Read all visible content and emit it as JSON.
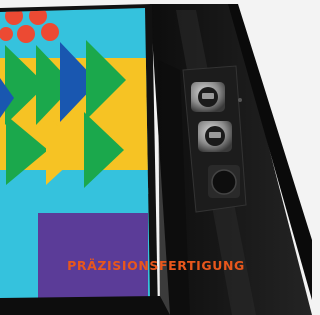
{
  "caption": {
    "text": "PRÄZISIONSFERTIGUNG"
  },
  "colors": {
    "caption": "#e8571c",
    "background": "#f3f3f3",
    "frame": "#161616",
    "screen_cyan": "#35c2dd",
    "screen_green": "#1ba84c",
    "screen_blue": "#1957b0",
    "screen_yellow": "#f6c324",
    "screen_purple": "#5b3c98",
    "screen_red": "#ec4a33"
  },
  "image": {
    "subject": "photo",
    "icons": [
      "usb-port-icon",
      "usb-port-icon",
      "power-button-icon"
    ]
  }
}
